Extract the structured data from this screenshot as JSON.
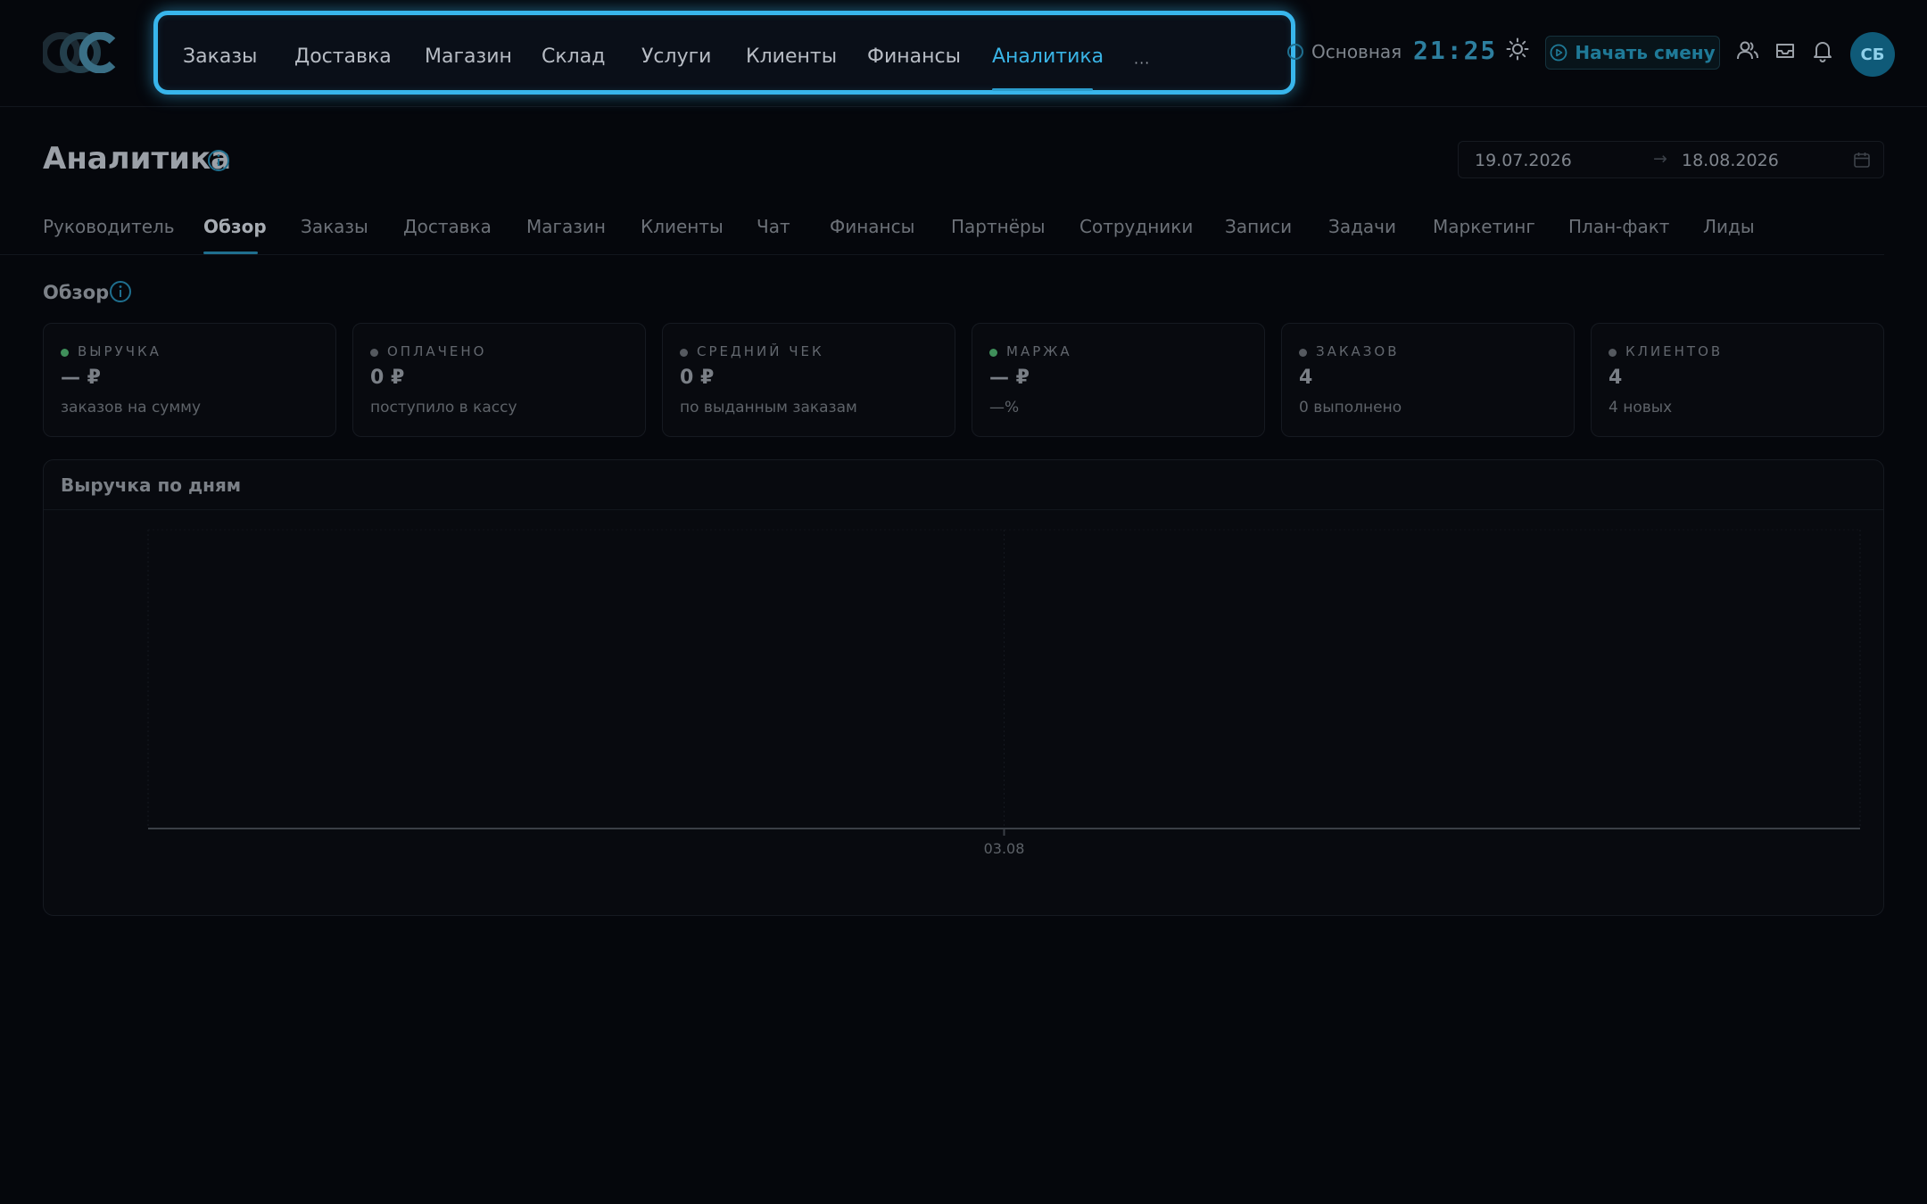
{
  "header": {
    "logo_text": "CCC",
    "nav_items": [
      {
        "label": "Заказы"
      },
      {
        "label": "Доставка"
      },
      {
        "label": "Магазин"
      },
      {
        "label": "Склад"
      },
      {
        "label": "Услуги"
      },
      {
        "label": "Клиенты"
      },
      {
        "label": "Финансы"
      },
      {
        "label": "Аналитика",
        "active": true
      }
    ],
    "nav_more": "···",
    "branch": "Основная",
    "clock": "21:25",
    "start_shift": "Начать смену",
    "avatar_initials": "СБ"
  },
  "page": {
    "title": "Аналитика",
    "date_from": "19.07.2026",
    "date_arrow": "→",
    "date_to": "18.08.2026"
  },
  "tabs": [
    {
      "label": "Руководитель"
    },
    {
      "label": "Обзор",
      "active": true
    },
    {
      "label": "Заказы"
    },
    {
      "label": "Доставка"
    },
    {
      "label": "Магазин"
    },
    {
      "label": "Клиенты"
    },
    {
      "label": "Чат"
    },
    {
      "label": "Финансы"
    },
    {
      "label": "Партнёры"
    },
    {
      "label": "Сотрудники"
    },
    {
      "label": "Записи"
    },
    {
      "label": "Задачи"
    },
    {
      "label": "Маркетинг"
    },
    {
      "label": "План-факт"
    },
    {
      "label": "Лиды"
    }
  ],
  "overview": {
    "title": "Обзор",
    "cards": [
      {
        "label": "ВЫРУЧКА",
        "value": "— ₽",
        "sub": "заказов на сумму",
        "dot": "#3f8f5a"
      },
      {
        "label": "ОПЛАЧЕНО",
        "value": "0 ₽",
        "sub": "поступило в кассу",
        "dot": "#55595f"
      },
      {
        "label": "СРЕДНИЙ ЧЕК",
        "value": "0 ₽",
        "sub": "по выданным заказам",
        "dot": "#55595f"
      },
      {
        "label": "МАРЖА",
        "value": "— ₽",
        "sub": "—%",
        "dot": "#3f8f5a"
      },
      {
        "label": "ЗАКАЗОВ",
        "value": "4",
        "sub": "0 выполнено",
        "dot": "#55595f"
      },
      {
        "label": "КЛИЕНТОВ",
        "value": "4",
        "sub": "4 новых",
        "dot": "#55595f"
      }
    ]
  },
  "chart": {
    "title": "Выручка по дням"
  },
  "chart_data": {
    "type": "line",
    "title": "Выручка по дням",
    "x": [
      "03.08"
    ],
    "series": [
      {
        "values": [
          0
        ]
      }
    ],
    "grid": true
  },
  "colors": {
    "accent": "#38b6ec",
    "background": "#05070c",
    "positive_dot": "#3f8f5a"
  }
}
